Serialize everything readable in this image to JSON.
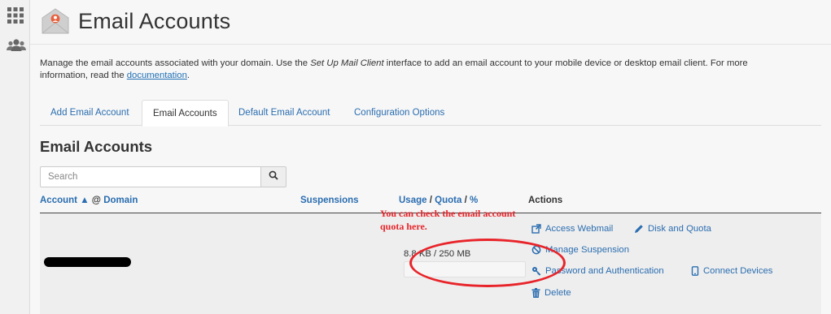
{
  "sidebar": {
    "items": [
      {
        "icon": "grid-icon"
      },
      {
        "icon": "users-icon"
      }
    ]
  },
  "header": {
    "title": "Email Accounts",
    "icon": "email-accounts-icon"
  },
  "description": {
    "part1": "Manage the email accounts associated with your domain. Use the ",
    "emphasis": "Set Up Mail Client",
    "part2": " interface to add an email account to your mobile device or desktop email client. For more information, read the ",
    "link": "documentation",
    "part3": "."
  },
  "tabs": [
    {
      "label": "Add Email Account",
      "active": false
    },
    {
      "label": "Email Accounts",
      "active": true
    },
    {
      "label": "Default Email Account",
      "active": false
    },
    {
      "label": "Configuration Options",
      "active": false
    }
  ],
  "section": {
    "title": "Email Accounts"
  },
  "search": {
    "placeholder": "Search",
    "value": ""
  },
  "table": {
    "columns": {
      "account": "Account",
      "sort_arrow": "▲",
      "at": "@",
      "domain": "Domain",
      "suspensions": "Suspensions",
      "usage": "Usage",
      "slash": "/",
      "quota": "Quota",
      "percent": "%",
      "actions": "Actions"
    },
    "rows": [
      {
        "account": "[redacted]",
        "usage": "8.8 KB / 250 MB",
        "usage_fraction": 0.0,
        "actions": {
          "webmail": "Access Webmail",
          "disk": "Disk and Quota",
          "suspension": "Manage Suspension",
          "password": "Password and Authentication",
          "devices": "Connect Devices",
          "delete": "Delete"
        }
      }
    ]
  },
  "annotation": {
    "text": "You can check the email account quota here.",
    "color": "#e8242a"
  },
  "colors": {
    "link": "#2a6db0",
    "accent": "#e8603c"
  }
}
